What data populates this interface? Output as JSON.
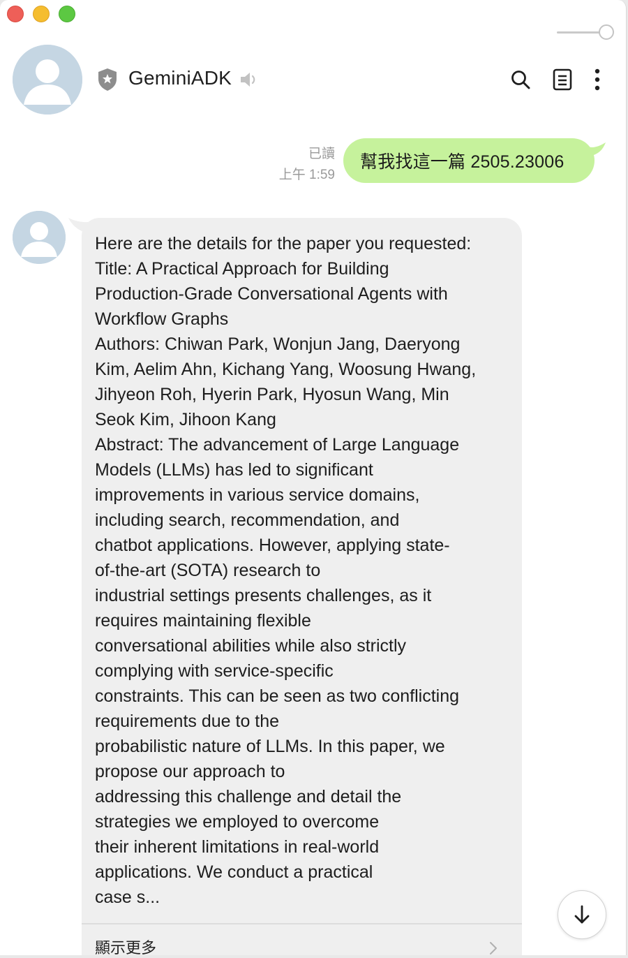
{
  "window": {
    "controls": [
      "close",
      "minimize",
      "maximize"
    ],
    "colors": {
      "close": "#ee5f58",
      "minimize": "#f5bd2f",
      "maximize": "#5cc842"
    }
  },
  "header": {
    "name": "GeminiADK",
    "badge_icon": "shield-star-icon",
    "mute_icon": "speaker-icon",
    "actions": [
      "search-icon",
      "notes-icon",
      "more-vertical-icon"
    ]
  },
  "messages": {
    "outgoing": {
      "read_status": "已讀",
      "time": "上午 1:59",
      "text": "幫我找這一篇 2505.23006",
      "bubble_color": "#c6f29c"
    },
    "incoming": {
      "lines": [
        "Here are the details for the paper you requested:",
        "Title: A Practical Approach for Building",
        "Production-Grade Conversational Agents with",
        "Workflow Graphs",
        "Authors: Chiwan Park, Wonjun Jang, Daeryong",
        "Kim, Aelim Ahn, Kichang Yang, Woosung Hwang,",
        "Jihyeon Roh, Hyerin Park, Hyosun Wang, Min",
        "Seok Kim, Jihoon Kang",
        "Abstract: The advancement of Large Language",
        "Models (LLMs) has led to significant",
        "improvements in various service domains,",
        "including search, recommendation, and",
        "chatbot applications. However, applying state-",
        "of-the-art (SOTA) research to",
        "industrial settings presents challenges, as it",
        "requires maintaining flexible",
        "conversational abilities while also strictly",
        "complying with service-specific",
        "constraints. This can be seen as two conflicting",
        "requirements due to the",
        "probabilistic nature of LLMs. In this paper, we",
        "propose our approach to",
        "addressing this challenge and detail the",
        "strategies we employed to overcome",
        "their inherent limitations in real-world",
        "applications. We conduct a practical",
        "case s..."
      ],
      "show_more": "顯示更多",
      "bubble_color": "#efefef"
    }
  },
  "scroll_button_icon": "arrow-down-icon"
}
